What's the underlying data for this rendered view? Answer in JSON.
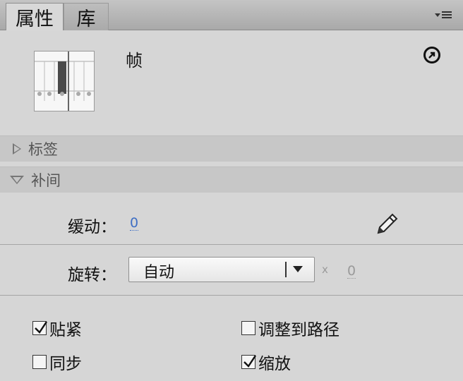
{
  "tabs": [
    {
      "label": "属性",
      "active": true
    },
    {
      "label": "库",
      "active": false
    }
  ],
  "panel_menu_icon": "panel-options-icon",
  "header": {
    "title": "帧",
    "thumbnail_icon": "frame-thumbnail-icon",
    "help_icon": "link-arrow-icon"
  },
  "sections": {
    "label_section": {
      "label": "标签",
      "expanded": false
    },
    "tween_section": {
      "label": "补间",
      "expanded": true
    }
  },
  "ease": {
    "label": "缓动：",
    "value": "0",
    "edit_icon": "pencil-icon"
  },
  "rotate": {
    "label": "旋转：",
    "selected": "自动",
    "times_symbol": "x",
    "count": "0"
  },
  "options": {
    "snap": {
      "label": "贴紧",
      "checked": true
    },
    "orient": {
      "label": "调整到路径",
      "checked": false
    },
    "sync": {
      "label": "同步",
      "checked": false
    },
    "scale": {
      "label": "缩放",
      "checked": true
    }
  },
  "colors": {
    "link": "#3f6fc4",
    "panel_bg": "#d6d6d6",
    "section_bg": "#c7c7c7"
  }
}
